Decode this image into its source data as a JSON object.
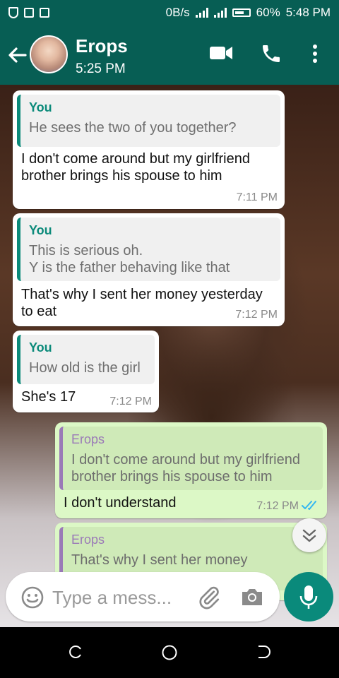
{
  "status_bar": {
    "net_speed": "0B/s",
    "battery_pct": "60%",
    "time": "5:48 PM"
  },
  "header": {
    "contact_name": "Erops",
    "last_seen": "5:25 PM"
  },
  "messages": [
    {
      "direction": "in",
      "quote_author": "You",
      "quote_text": "He sees the two of you together?",
      "text": "I don't come around but my girlfriend\nbrother brings his spouse to him",
      "time": "7:11 PM"
    },
    {
      "direction": "in",
      "quote_author": "You",
      "quote_text": "This is serious oh.\nY is the father behaving like that",
      "text": "That's why I sent her money yesterday\nto eat",
      "time": "7:12 PM"
    },
    {
      "direction": "in",
      "quote_author": "You",
      "quote_text": "How old is the girl",
      "text": "She's 17",
      "time": "7:12 PM"
    },
    {
      "direction": "out",
      "quote_author": "Erops",
      "quote_text": "I don't come around but my girlfriend\nbrother brings his spouse to him",
      "text": "I don't understand",
      "time": "7:12 PM",
      "status": "read"
    },
    {
      "direction": "out",
      "quote_author": "Erops",
      "quote_text": "That's why I sent her money"
    }
  ],
  "composer": {
    "placeholder": "Type a mess..."
  },
  "colors": {
    "header_bg": "#075e54",
    "outgoing_bubble": "#dcf8c6",
    "incoming_bubble": "#ffffff",
    "accent": "#0a8a7b",
    "read_ticks": "#34b7f1"
  }
}
